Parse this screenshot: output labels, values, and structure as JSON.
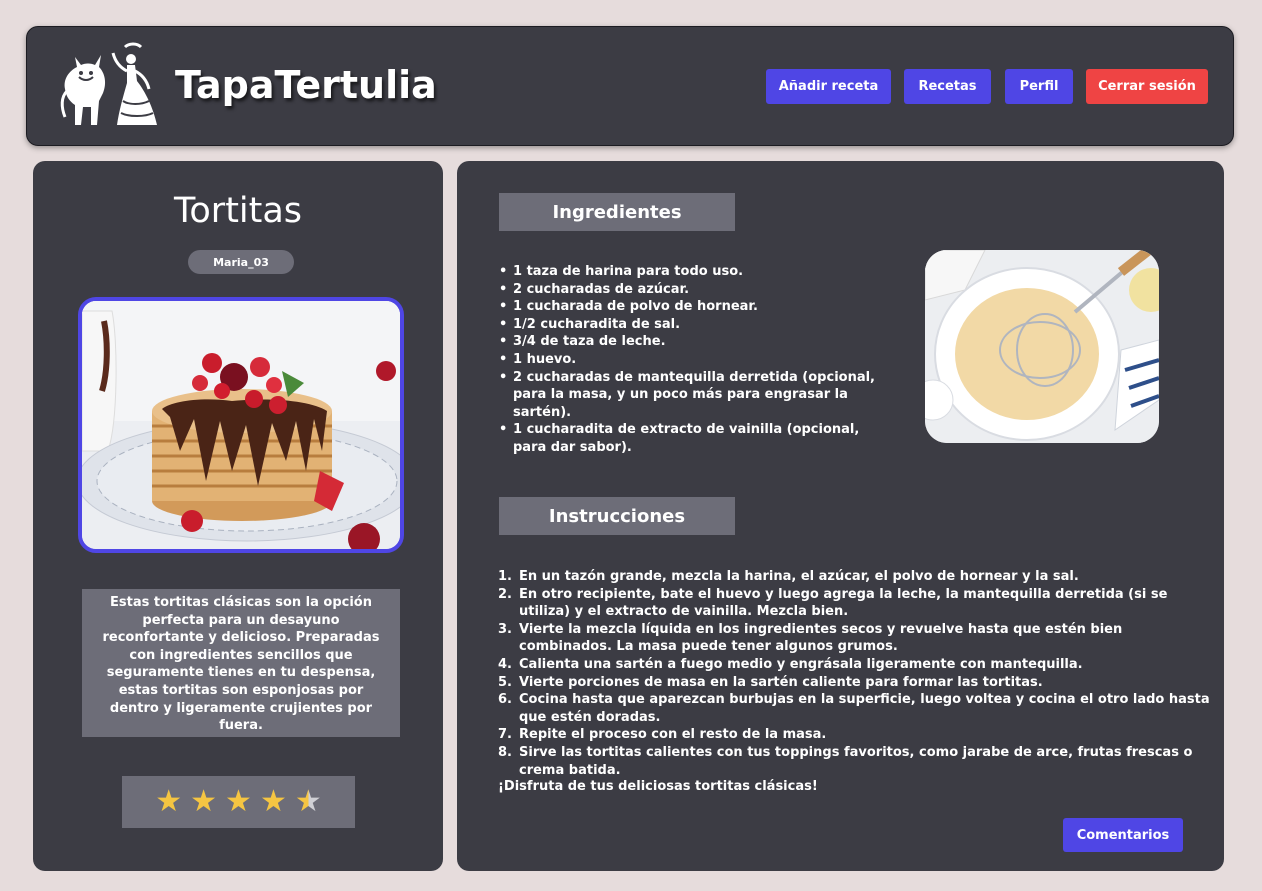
{
  "header": {
    "brand": "TapaTertulia",
    "nav": [
      {
        "label": "Añadir receta"
      },
      {
        "label": "Recetas"
      },
      {
        "label": "Perfil"
      },
      {
        "label": "Cerrar sesión"
      }
    ]
  },
  "recipe": {
    "title": "Tortitas",
    "author": "Maria_03",
    "description": "Estas tortitas clásicas son la opción perfecta para un desayuno reconfortante y delicioso. Preparadas con ingredientes sencillos que seguramente tienes en tu despensa, estas tortitas son esponjosas por dentro y ligeramente crujientes por fuera.",
    "rating": 4.5,
    "rating_max": 5
  },
  "ingredients": {
    "heading": "Ingredientes",
    "items": [
      "1 taza de harina para todo uso.",
      "2 cucharadas de azúcar.",
      "1 cucharada de polvo de hornear.",
      "1/2 cucharadita de sal.",
      "3/4 de taza de leche.",
      "1 huevo.",
      "2 cucharadas de mantequilla derretida (opcional, para la masa, y un poco más para engrasar la sartén).",
      "1 cucharadita de extracto de vainilla (opcional, para dar sabor)."
    ]
  },
  "instructions": {
    "heading": "Instrucciones",
    "steps": [
      "En un tazón grande, mezcla la harina, el azúcar, el polvo de hornear y la sal.",
      "En otro recipiente, bate el huevo y luego agrega la leche, la mantequilla derretida (si se utiliza) y el extracto de vainilla. Mezcla bien.",
      "Vierte la mezcla líquida en los ingredientes secos y revuelve hasta que estén bien combinados. La masa puede tener algunos grumos.",
      "Calienta una sartén a fuego medio y engrásala ligeramente con mantequilla.",
      "Vierte porciones de masa en la sartén caliente para formar las tortitas.",
      "Cocina hasta que aparezcan burbujas en la superficie, luego voltea y cocina el otro lado hasta que estén doradas.",
      "Repite el proceso con el resto de la masa.",
      "Sirve las tortitas calientes con tus toppings favoritos, como jarabe de arce, frutas frescas o crema batida."
    ],
    "outro": "¡Disfruta de tus deliciosas tortitas clásicas!"
  },
  "comments_label": "Comentarios",
  "colors": {
    "background": "#e6dcdc",
    "panel": "#3c3c44",
    "box": "#6d6d78",
    "accent": "#4f46e5",
    "danger": "#ef4444",
    "star": "#f5c542"
  }
}
